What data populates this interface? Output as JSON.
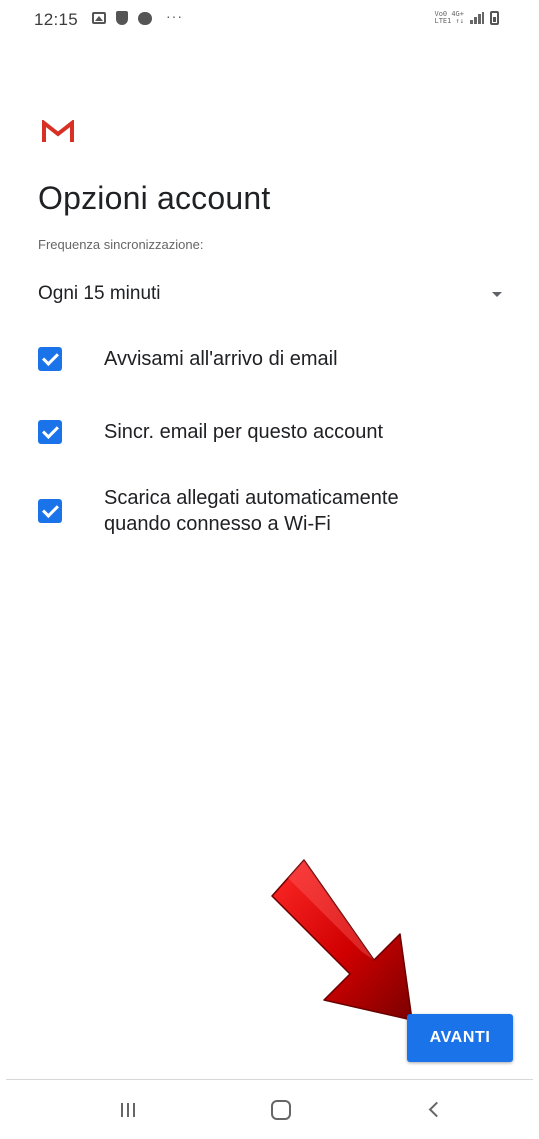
{
  "status_bar": {
    "time": "12:15",
    "more": "···",
    "icons_left": [
      "image-icon",
      "shield-icon",
      "message-icon"
    ],
    "icons_right": [
      "volte-icon",
      "signal-icon",
      "battery-icon"
    ],
    "volte_line1": "Vo0 4G+",
    "volte_line2": "LTE1 ↑↓"
  },
  "brand": {
    "logo": "gmail-logo",
    "color": "#d93025"
  },
  "page": {
    "title": "Opzioni account",
    "sync_label": "Frequenza sincronizzazione:",
    "sync_value": "Ogni 15 minuti"
  },
  "options": [
    {
      "label": "Avvisami all'arrivo di email",
      "checked": true
    },
    {
      "label": "Sincr. email per questo account",
      "checked": true
    },
    {
      "label": "Scarica allegati automaticamente quando connesso a Wi-Fi",
      "checked": true
    }
  ],
  "next_button": {
    "label": "AVANTI"
  },
  "colors": {
    "accent": "#1a73e8",
    "arrow": "#c40000"
  },
  "nav": {
    "recent": "recent-apps-icon",
    "home": "home-icon",
    "back": "back-icon"
  }
}
